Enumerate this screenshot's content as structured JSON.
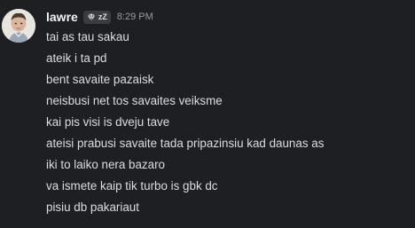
{
  "message": {
    "author": "lawre",
    "badge": {
      "icon": "diamond-icon",
      "text": "zZ"
    },
    "timestamp": "8:29 PM",
    "lines": [
      "tai as tau sakau",
      "ateik i ta pd",
      "bent savaite pazaisk",
      "neisbusi net tos savaites veiksme",
      "kai pis visi is dveju tave",
      "ateisi prabusi savaite tada pripazinsiu kad daunas as",
      "iki to laiko nera bazaro",
      "va ismete kaip tik turbo is gbk dc",
      "pisiu db pakariaut"
    ]
  }
}
